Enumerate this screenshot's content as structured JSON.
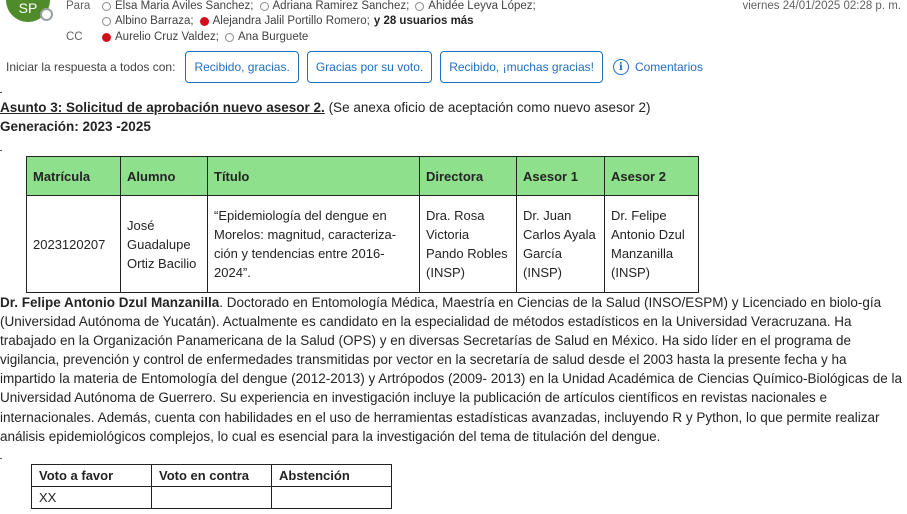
{
  "header": {
    "avatar_initials": "SP",
    "to_label": "Para",
    "to_recipients": [
      {
        "name": "Elsa Maria Aviles Sanchez;",
        "status": "offline"
      },
      {
        "name": "Adriana Ramirez Sanchez;",
        "status": "offline"
      },
      {
        "name": "Ahidée Leyva López;",
        "status": "offline"
      }
    ],
    "to_recipients_line2": [
      {
        "name": "Albino Barraza;",
        "status": "offline"
      },
      {
        "name": "Alejandra Jalil Portillo Romero;",
        "status": "busy"
      }
    ],
    "more_recipients": "y 28 usuarios más",
    "cc_label": "CC",
    "cc_recipients": [
      {
        "name": "Aurelio Cruz Valdez;",
        "status": "busy"
      },
      {
        "name": "Ana Burguete",
        "status": "offline"
      }
    ],
    "date": "viernes 24/01/2025 02:28 p. m."
  },
  "quick_reply": {
    "label": "Iniciar la respuesta a todos con:",
    "buttons": [
      "Recibido, gracias.",
      "Gracias por su voto.",
      "Recibido, ¡muchas gracias!"
    ],
    "comments_label": "Comentarios",
    "icon": "info-icon"
  },
  "body": {
    "subject_bold": "Asunto 3: Solicitud de aprobación nuevo asesor 2.",
    "subject_rest": " (Se anexa oficio de aceptación como nuevo asesor 2)",
    "generation": "Generación: 2023 -2025",
    "table": {
      "headers": [
        "Matrícula",
        "Alumno",
        "Título",
        "Directora",
        "Asesor 1",
        "Asesor 2"
      ],
      "row": [
        "2023120207",
        "José Guadalupe Ortiz Bacilio",
        "“Epidemiología del dengue en Morelos: magnitud, caracteriza-ción y tendencias entre 2016-2024”.",
        "Dra. Rosa Victoria Pando Robles (INSP)",
        "Dr. Juan Carlos Ayala García (INSP)",
        "Dr. Felipe Antonio Dzul Manzanilla (INSP)"
      ]
    },
    "paragraph_name": "Dr. Felipe Antonio Dzul Manzanilla",
    "paragraph_text": ". Doctorado en Entomología Médica, Maestría en Ciencias de la Salud (INSO/ESPM) y Licenciado en biolo-gía  (Universidad Autónoma de Yucatán). Actualmente es candidato en la especialidad de métodos estadísticos en la Universidad Veracruzana. Ha trabajado en la Organización Panamericana de la Salud (OPS) y en diversas Secretarías de Salud en México. Ha sido líder en el programa de vigilancia, prevención y control de enfermedades transmitidas por vector en la secretaría de salud desde el 2003 hasta la presente fecha y ha impartido la materia de Entomología del dengue (2012-2013) y Artrópodos (2009- 2013) en la Unidad Académica de Ciencias Químico-Biológicas de la Universidad Autónoma de Guerrero. Su experiencia en investigación incluye la publicación de artículos científicos en revistas nacionales e internacionales. Además, cuenta con habilidades en el uso de herramientas estadísticas avanzadas, incluyendo R y Python, lo que permite realizar análisis epidemiológicos complejos, lo cual es esencial para la investigación del tema de titulación del dengue.",
    "vote_table": {
      "headers": [
        "Voto a favor",
        "Voto en contra",
        "Abstención"
      ],
      "row": [
        "XX",
        "",
        ""
      ]
    }
  },
  "colors": {
    "accent": "#1f6fc1",
    "table_header": "#8fe08c",
    "busy": "#d40f1c"
  }
}
